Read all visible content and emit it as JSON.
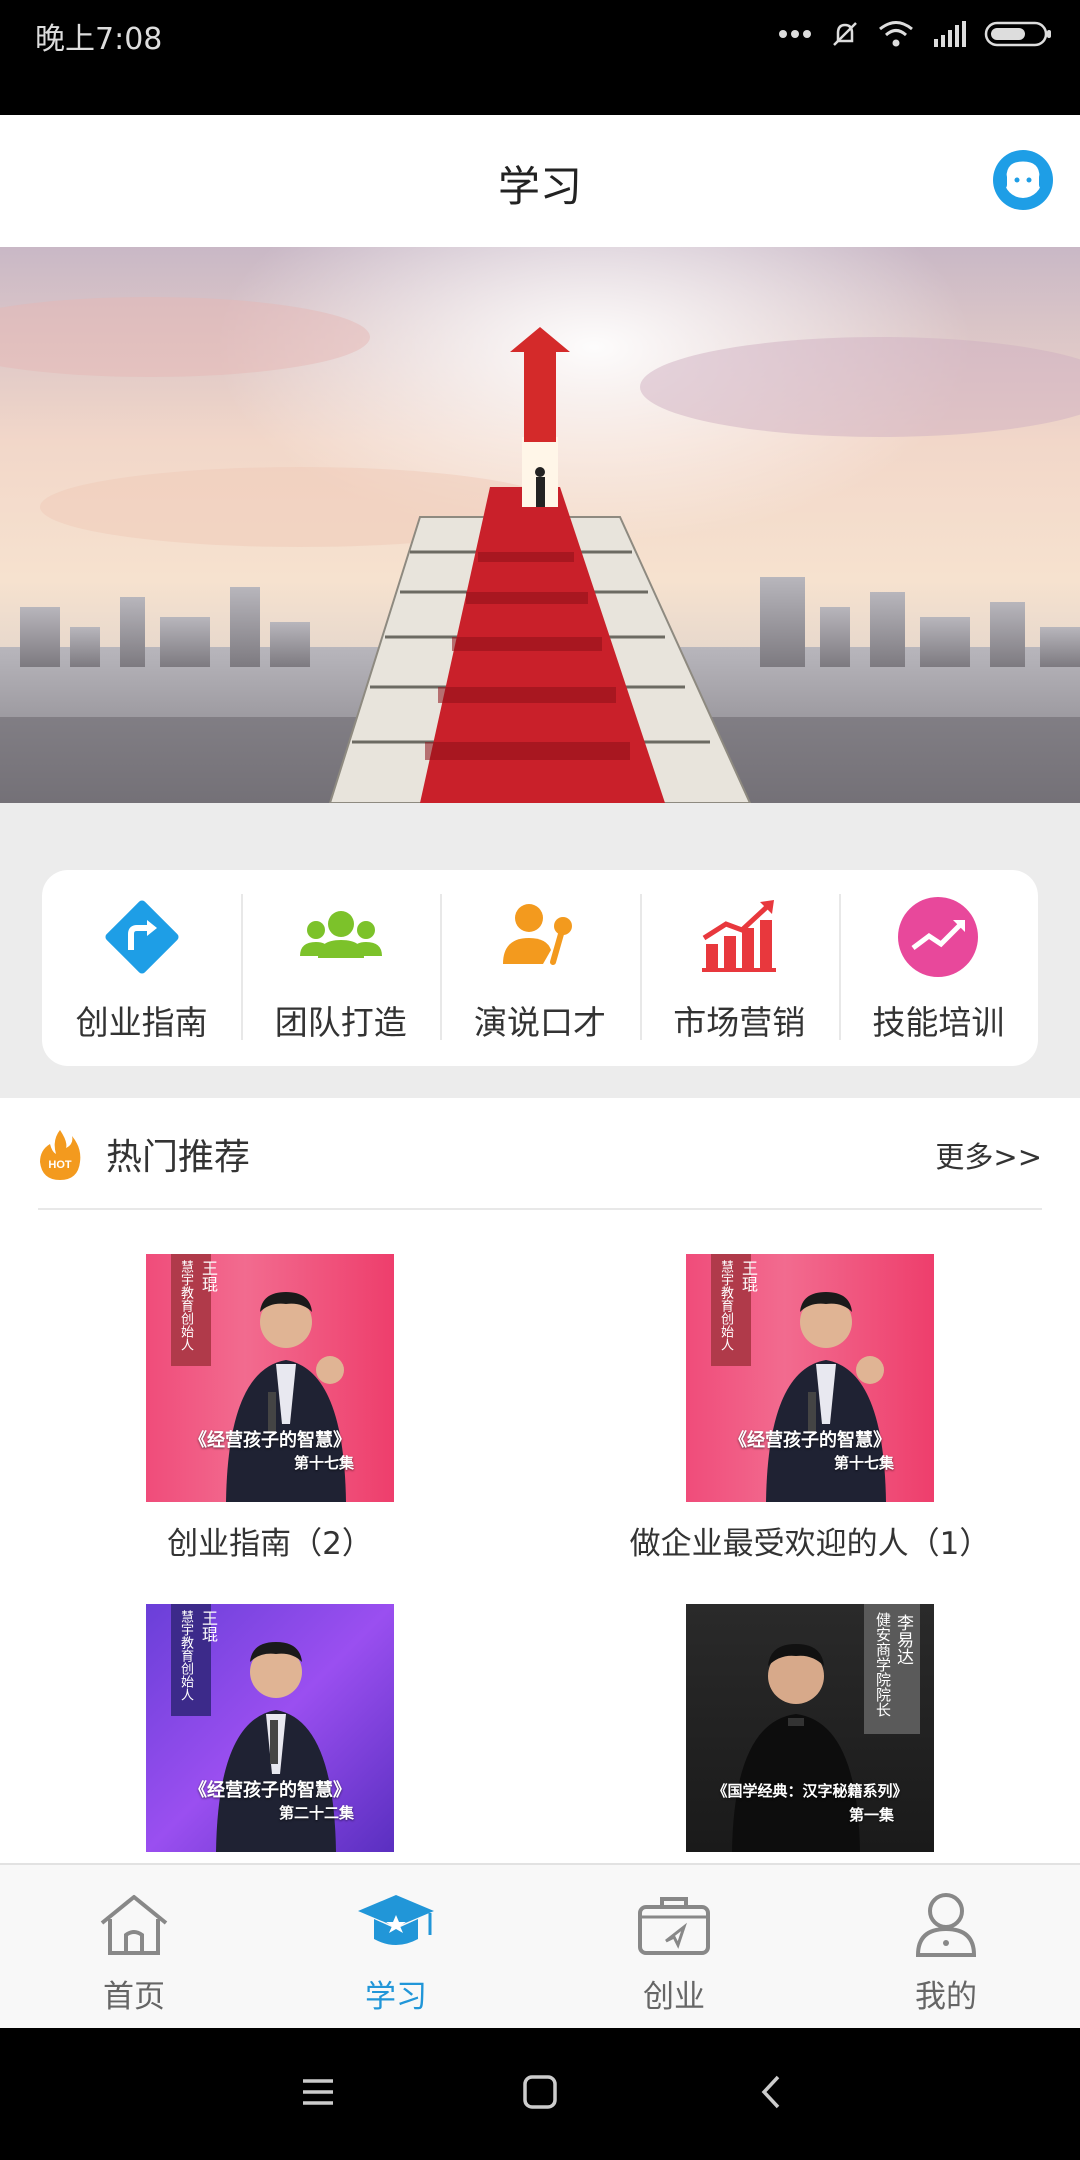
{
  "status_bar": {
    "time": "晚上7:08"
  },
  "header": {
    "title": "学习"
  },
  "categories": [
    {
      "label": "创业指南",
      "icon": "diamond-arrow-icon",
      "color": "#1e9ee6"
    },
    {
      "label": "团队打造",
      "icon": "team-icon",
      "color": "#7cc22a"
    },
    {
      "label": "演说口才",
      "icon": "speaker-mic-icon",
      "color": "#f39a1e"
    },
    {
      "label": "市场营销",
      "icon": "bar-chart-up-icon",
      "color": "#e8383d"
    },
    {
      "label": "技能培训",
      "icon": "trend-circle-icon",
      "color": "#e8489b"
    }
  ],
  "hot": {
    "badge": "HOT",
    "title": "热门推荐",
    "more": "更多>>",
    "items": [
      {
        "title": "创业指南（2）",
        "cover": {
          "vertical_1": "慧宇教育创始人",
          "vertical_2": "王琨",
          "caption": "《经营孩子的智慧》",
          "episode": "第十七集"
        }
      },
      {
        "title": "做企业最受欢迎的人（1）",
        "cover": {
          "vertical_1": "慧宇教育创始人",
          "vertical_2": "王琨",
          "caption": "《经营孩子的智慧》",
          "episode": "第十七集"
        }
      },
      {
        "title": "",
        "cover": {
          "vertical_1": "慧宇教育创始人",
          "vertical_2": "王琨",
          "caption": "《经营孩子的智慧》",
          "episode": "第二十二集"
        }
      },
      {
        "title": "",
        "cover": {
          "vertical_1": "健安商学院院长",
          "vertical_2": "李易达",
          "caption": "《国学经典：汉字秘籍系列》",
          "episode": "第一集"
        }
      }
    ]
  },
  "tabs": [
    {
      "label": "首页",
      "icon": "home-icon",
      "active": false
    },
    {
      "label": "学习",
      "icon": "graduation-cap-icon",
      "active": true
    },
    {
      "label": "创业",
      "icon": "briefcase-icon",
      "active": false
    },
    {
      "label": "我的",
      "icon": "user-icon",
      "active": false
    }
  ],
  "colors": {
    "accent": "#2196d8",
    "banner_red": "#d42a2a"
  }
}
